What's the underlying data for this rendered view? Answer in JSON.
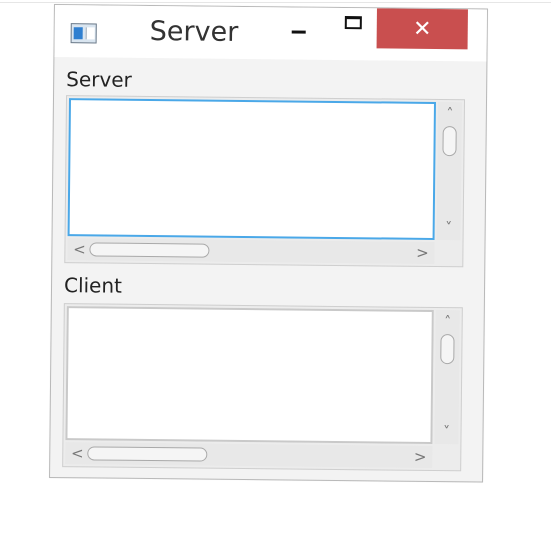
{
  "window": {
    "title": "Server",
    "controls": {
      "minimize_icon": "minimize-icon",
      "maximize_icon": "maximize-icon",
      "close_symbol": "✕",
      "close_color": "#c94f4f"
    },
    "app_icon": "window-app-icon"
  },
  "server_group": {
    "label": "Server",
    "text": "",
    "focus_color": "#4aa8e8"
  },
  "client_group": {
    "label": "Client",
    "text": ""
  },
  "scrollbar": {
    "up_arrow": "˄",
    "down_arrow": "˅",
    "left_arrow": "<",
    "right_arrow": ">"
  }
}
